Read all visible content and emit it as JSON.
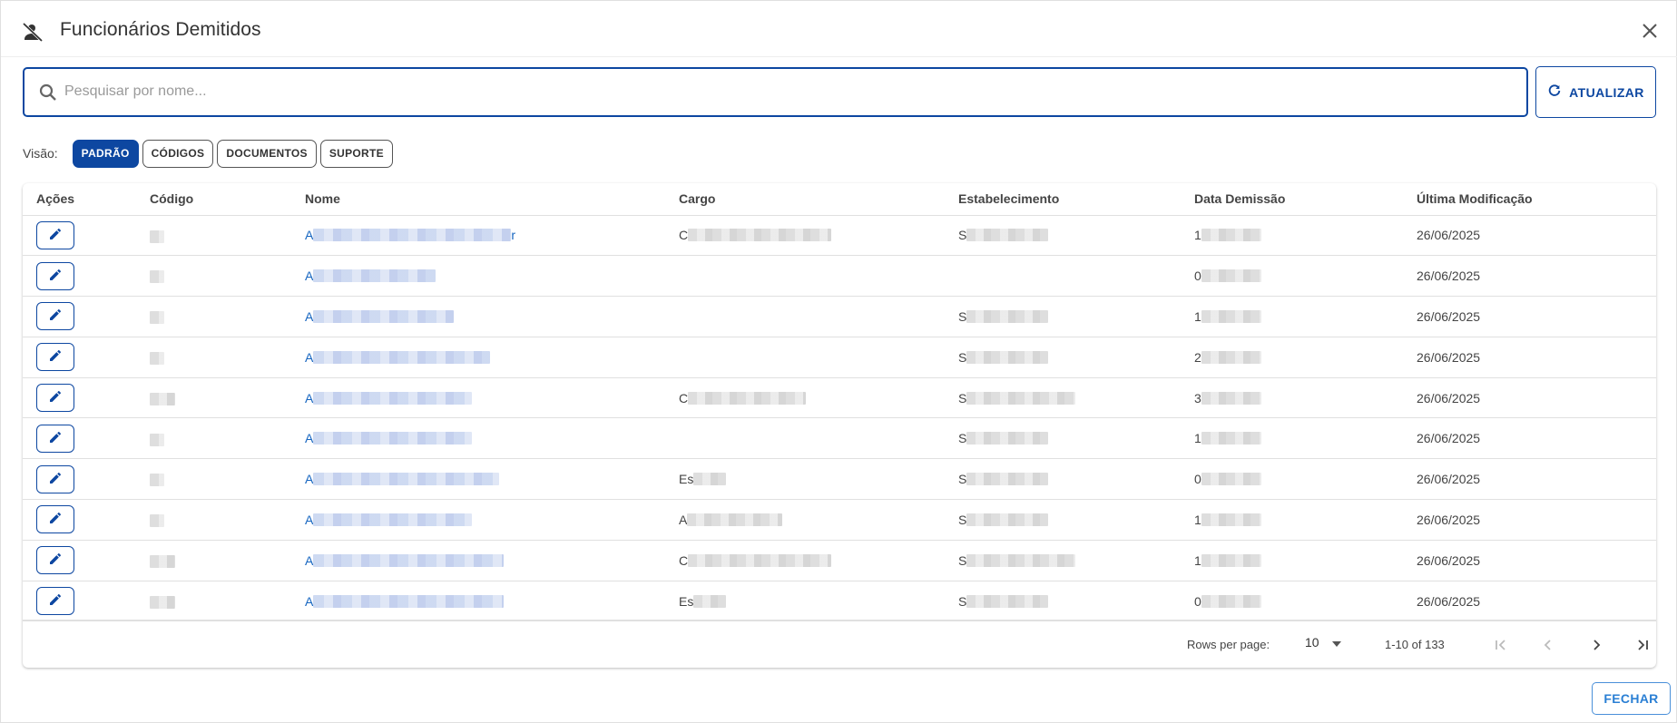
{
  "dialog": {
    "title": "Funcionários Demitidos",
    "header_icon": "person-off-icon",
    "close_icon": "close-icon"
  },
  "search": {
    "placeholder": "Pesquisar por nome...",
    "value": "",
    "refresh_label": "ATUALIZAR"
  },
  "view": {
    "label": "Visão:",
    "chips": [
      {
        "label": "PADRÃO",
        "active": true
      },
      {
        "label": "CÓDIGOS",
        "active": false
      },
      {
        "label": "DOCUMENTOS",
        "active": false
      },
      {
        "label": "SUPORTE",
        "active": false
      }
    ]
  },
  "table": {
    "columns": [
      "Ações",
      "Código",
      "Nome",
      "Cargo",
      "Estabelecimento",
      "Data Demissão",
      "Última Modificação"
    ],
    "rows": [
      {
        "nome": "A",
        "nome_suffix": "r",
        "cargo": "C",
        "estab": "S",
        "data": "1",
        "modificacao": "26/06/2025"
      },
      {
        "nome": "A",
        "nome_suffix": "",
        "cargo": "",
        "estab": "",
        "data": "0",
        "modificacao": "26/06/2025"
      },
      {
        "nome": "A",
        "nome_suffix": "",
        "cargo": "",
        "estab": "S",
        "data": "1",
        "modificacao": "26/06/2025"
      },
      {
        "nome": "A",
        "nome_suffix": "",
        "cargo": "",
        "estab": "S",
        "data": "2",
        "modificacao": "26/06/2025"
      },
      {
        "nome": "A",
        "nome_suffix": "",
        "cargo": "C",
        "estab": "S",
        "data": "3",
        "modificacao": "26/06/2025"
      },
      {
        "nome": "A",
        "nome_suffix": "",
        "cargo": "",
        "estab": "S",
        "data": "1",
        "modificacao": "26/06/2025"
      },
      {
        "nome": "A",
        "nome_suffix": "",
        "cargo": "Es",
        "estab": "S",
        "data": "0",
        "modificacao": "26/06/2025"
      },
      {
        "nome": "A",
        "nome_suffix": "",
        "cargo": "A",
        "estab": "S",
        "data": "1",
        "modificacao": "26/06/2025"
      },
      {
        "nome": "A",
        "nome_suffix": "",
        "cargo": "C",
        "estab": "S",
        "data": "1",
        "modificacao": "26/06/2025"
      },
      {
        "nome": "A",
        "nome_suffix": "",
        "cargo": "Es",
        "estab": "S",
        "data": "0",
        "modificacao": "26/06/2025"
      }
    ]
  },
  "pagination": {
    "rows_per_page_label": "Rows per page:",
    "rows_per_page_value": "10",
    "range_label": "1-10 of 133"
  },
  "footer": {
    "close_label": "FECHAR"
  },
  "colors": {
    "primary": "#0d47a1",
    "link": "#1565c0",
    "footer_button": "#2a7fd4"
  }
}
